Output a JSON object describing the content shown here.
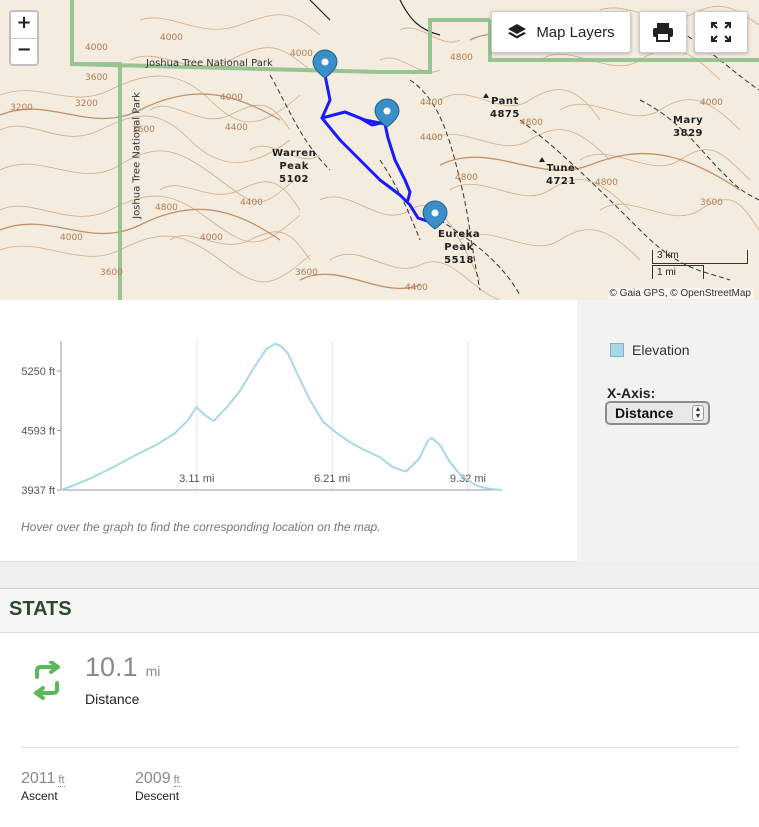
{
  "map": {
    "zoom_in": "+",
    "zoom_out": "−",
    "layers_label": "Map Layers",
    "attribution": "© Gaia GPS, © OpenStreetMap",
    "scale_km": "3 km",
    "scale_mi": "1 mi",
    "park_label_top": "Joshua Tree National Park",
    "park_label_side": "Joshua Tree National Park",
    "peaks": [
      {
        "name": "Warren Peak",
        "line1": "Warren",
        "line2": "Peak",
        "elev": "5102"
      },
      {
        "name": "Eureka Peak",
        "line1": "Eureka",
        "line2": "Peak",
        "elev": "5518"
      },
      {
        "name": "Pant",
        "line1": "Pant",
        "line2": "",
        "elev": "4875"
      },
      {
        "name": "Mary",
        "line1": "Mary",
        "line2": "",
        "elev": "3829"
      },
      {
        "name": "Tune",
        "line1": "Tune",
        "line2": "",
        "elev": "4721"
      }
    ],
    "contour_labels": [
      "4000",
      "4000",
      "3600",
      "3200",
      "3600",
      "4000",
      "4400",
      "4400",
      "4800",
      "4000",
      "3600",
      "4000",
      "4400",
      "4800",
      "4400",
      "4800",
      "4000",
      "3200",
      "3600",
      "4800",
      "3600",
      "4000",
      "4400",
      "4800"
    ]
  },
  "chart": {
    "legend": "Elevation",
    "xaxis_label": "X-Axis:",
    "xaxis_value": "Distance",
    "hover_hint": "Hover over the graph to find the corresponding location on the map.",
    "series_color": "#a8d8e8"
  },
  "chart_data": {
    "type": "line",
    "title": "",
    "xlabel": "",
    "ylabel": "",
    "x_unit": "mi",
    "y_unit": "ft",
    "xlim": [
      0,
      10.1
    ],
    "ylim": [
      3937,
      5580
    ],
    "x_ticks": [
      "3.11 mi",
      "6.21 mi",
      "9.32 mi"
    ],
    "x_tick_values": [
      3.11,
      6.21,
      9.32
    ],
    "y_ticks": [
      "5250 ft",
      "4593 ft",
      "3937 ft"
    ],
    "y_tick_values": [
      5250,
      4593,
      3937
    ],
    "grid": "vertical",
    "series": [
      {
        "name": "Elevation",
        "x": [
          0,
          0.3,
          0.7,
          1.2,
          1.7,
          2.2,
          2.6,
          2.9,
          3.1,
          3.3,
          3.5,
          3.8,
          4.1,
          4.4,
          4.7,
          4.9,
          5.05,
          5.2,
          5.4,
          5.7,
          6.0,
          6.3,
          6.6,
          6.9,
          7.3,
          7.6,
          7.9,
          8.2,
          8.4,
          8.5,
          8.7,
          8.9,
          9.1,
          9.3,
          9.5,
          9.7,
          9.9,
          10.1
        ],
        "y": [
          3937,
          3990,
          4070,
          4190,
          4320,
          4440,
          4560,
          4700,
          4850,
          4760,
          4700,
          4850,
          5030,
          5270,
          5490,
          5550,
          5520,
          5440,
          5230,
          4930,
          4690,
          4570,
          4470,
          4390,
          4300,
          4190,
          4140,
          4280,
          4480,
          4510,
          4420,
          4250,
          4130,
          4050,
          3990,
          3960,
          3945,
          3937
        ]
      }
    ]
  },
  "stats": {
    "heading": "STATS",
    "distance_value": "10.1",
    "distance_unit": "mi",
    "distance_label": "Distance",
    "ascent_value": "2011",
    "ascent_unit": "ft",
    "ascent_label": "Ascent",
    "descent_value": "2009",
    "descent_unit": "ft",
    "descent_label": "Descent",
    "icon_color": "#5cb85c"
  }
}
